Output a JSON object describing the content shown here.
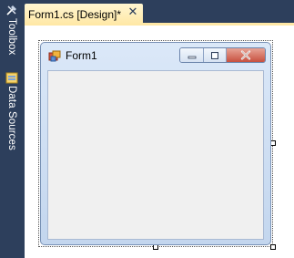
{
  "sidebar": {
    "tabs": [
      {
        "label": "Toolbox",
        "icon": "toolbox-icon"
      },
      {
        "label": "Data Sources",
        "icon": "data-sources-icon"
      }
    ]
  },
  "document_tab": {
    "title": "Form1.cs [Design]*",
    "close_glyph": "✕"
  },
  "form": {
    "title": "Form1",
    "icon": "form-icon",
    "buttons": [
      "minimize",
      "maximize",
      "close"
    ]
  },
  "colors": {
    "frame": "#2d3f5c",
    "active_tab": "#ffe8a6",
    "form_border": "#c3d6ee",
    "client": "#f0f0f0",
    "close_button": "#c7503f"
  }
}
